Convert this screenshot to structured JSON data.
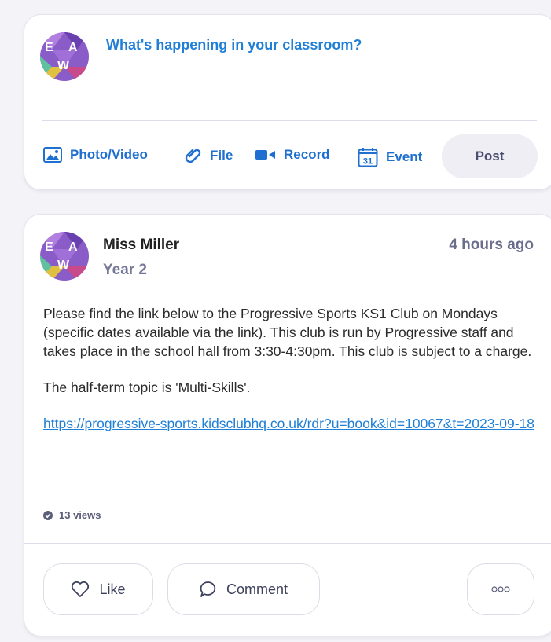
{
  "composer": {
    "prompt": "What's happening in your classroom?",
    "tools": {
      "photo": "Photo/Video",
      "file": "File",
      "record": "Record",
      "event": "Event",
      "event_day": "31"
    },
    "post_label": "Post"
  },
  "post": {
    "author": "Miss Miller",
    "group": "Year 2",
    "time": "4 hours ago",
    "paragraphs": [
      "Please find the link below to the Progressive Sports KS1 Club on Mondays (specific dates available via the link). This club is run by Progressive staff and takes place in the school hall from 3:30-4:30pm. This club is subject to a charge.",
      "The half-term topic is 'Multi-Skills'."
    ],
    "link": "https://progressive-sports.kidsclubhq.co.uk/rdr?u=book&id=10067&t=2023-09-18",
    "views": "13 views",
    "actions": {
      "like": "Like",
      "comment": "Comment"
    }
  },
  "avatar_letters": [
    "E",
    "A",
    "W"
  ],
  "colors": {
    "accent": "#1f7fd6",
    "avatar_purple": "#8a5cc8"
  }
}
